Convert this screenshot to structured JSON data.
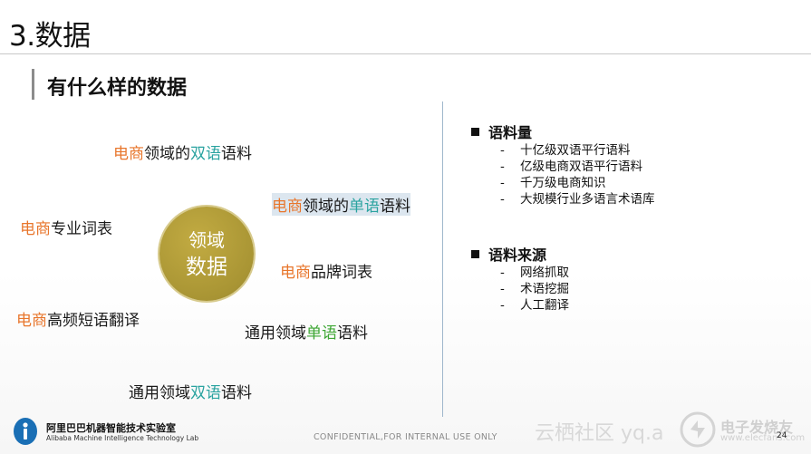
{
  "title": "3.数据",
  "subtitle": "有什么样的数据",
  "circle": {
    "line1": "领域",
    "line2": "数据"
  },
  "phrases": {
    "p1": {
      "a": "电商",
      "b": "领域的",
      "c": "双语",
      "d": "语料"
    },
    "p2": {
      "a": "电商",
      "b": "领域的",
      "c": "单语",
      "d": "语料"
    },
    "p3": {
      "a": "电商",
      "b": "专业词表"
    },
    "p4": {
      "a": "电商",
      "b": "品牌词表"
    },
    "p5": {
      "a": "电商",
      "b": "高频短语翻译"
    },
    "p6": {
      "a": "通用领域",
      "b": "单语",
      "c": "语料"
    },
    "p7": {
      "a": "通用领域",
      "b": "双语",
      "c": "语料"
    }
  },
  "sections": [
    {
      "heading": "语料量",
      "items": [
        "十亿级双语平行语料",
        "亿级电商双语平行语料",
        "千万级电商知识",
        "大规模行业多语言术语库"
      ]
    },
    {
      "heading": "语料来源",
      "items": [
        "网络抓取",
        "术语挖掘",
        "人工翻译"
      ]
    }
  ],
  "dash": "-",
  "page_number": "24",
  "footer": "CONFIDENTIAL,FOR INTERNAL USE ONLY",
  "logo": {
    "cn": "阿里巴巴机器智能技术实验室",
    "en": "Alibaba Machine Intelligence Technology Lab"
  },
  "watermark": {
    "left": "云栖社区 yq.a",
    "cn": "电子发烧友",
    "en": "www.elecfans.com"
  },
  "colors": {
    "orange": "#e8762c",
    "teal": "#2aa3a0",
    "green": "#3ea634",
    "circle": "#a99534"
  }
}
